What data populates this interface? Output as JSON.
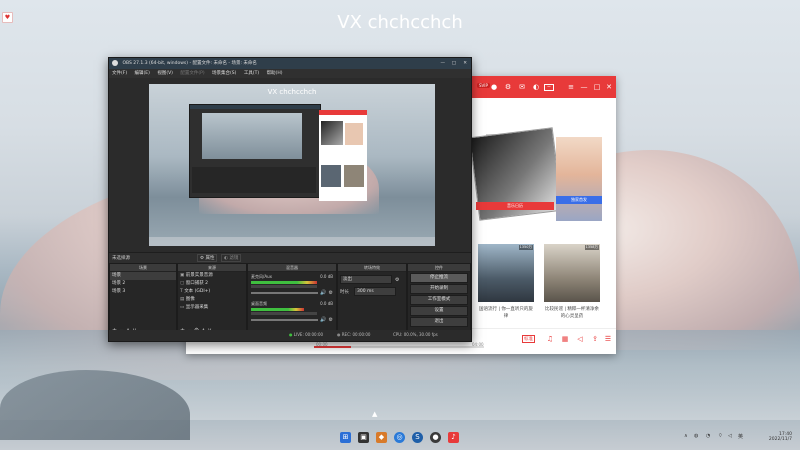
{
  "desktop": {
    "watermark": "VX chchcchch",
    "colors": {
      "music_red": "#e83a3a",
      "obs_dark": "#2b2b2b",
      "record_green": "#3fbf3f"
    }
  },
  "obs": {
    "window_title": "OBS 27.1.3 (64-bit, windows) - 配置文件: 未命名 - 场景: 未命名",
    "menu": [
      "文件(F)",
      "编辑(E)",
      "视图(V)",
      "配置文件(P)",
      "场景集合(S)",
      "工具(T)",
      "帮助(H)"
    ],
    "preview_watermark": "VX chchcchch",
    "no_source_selected": "未选择源",
    "properties_label": "属性",
    "filters_label": "滤镜",
    "scenes": {
      "header": "场景",
      "items": [
        "场景",
        "场景 2",
        "场景 3"
      ]
    },
    "sources": {
      "header": "来源",
      "items": [
        "前景实景音源",
        "窗口捕获 2",
        "文本 (GDI+)",
        "图像",
        "显示器采集"
      ]
    },
    "mixer": {
      "header": "混音器",
      "tracks": [
        {
          "name": "麦克风/Aux",
          "db": "0.0 dB"
        },
        {
          "name": "桌面音频",
          "db": "0.0 dB"
        }
      ]
    },
    "transitions": {
      "header": "转场特效",
      "selected": "淡出",
      "duration_label": "时长",
      "duration_value": "300 ms"
    },
    "controls": {
      "header": "控件",
      "buttons": [
        "停止推流",
        "开始录制",
        "工作室模式",
        "设置",
        "退出"
      ]
    },
    "status": {
      "live": "LIVE: 00:00:00",
      "rec": "REC: 00:00:00",
      "cpu": "CPU: 00.0%, 30.00 fps"
    }
  },
  "music": {
    "title_badge": "SVIP",
    "banner_left_caption": "音乐日历",
    "banner_right_caption": "独家首发",
    "cards": [
      {
        "caption": "国语流行 | 你一直听只的旋律",
        "badge": "1350万"
      },
      {
        "caption": "比较民谣 | 精粹一杯清净余的心灵呈药",
        "badge": "1358万"
      }
    ],
    "player_time": "00:00",
    "player_total": "04:00",
    "bottom_label": "标准"
  },
  "taskbar": {
    "icons": [
      "start-icon",
      "app-icon-1",
      "app-icon-2",
      "app-icon-3",
      "app-icon-4",
      "obs-icon",
      "music-icon"
    ],
    "clock_time": "17:40",
    "clock_date": "2022/11/7"
  }
}
